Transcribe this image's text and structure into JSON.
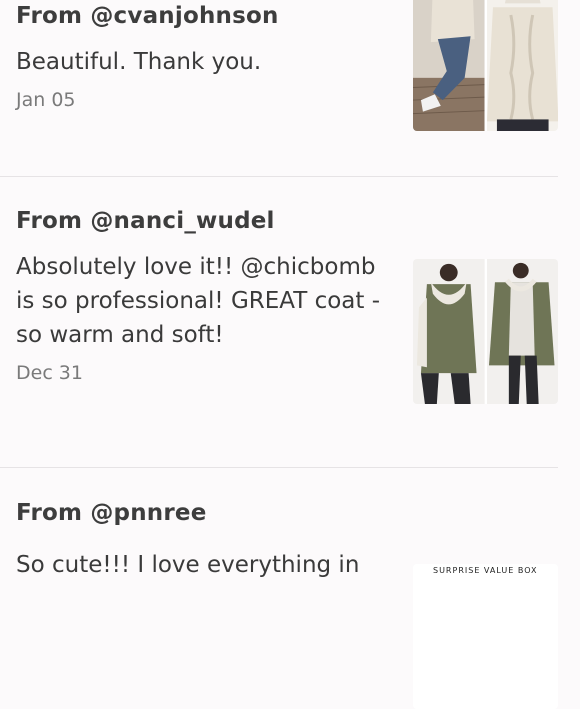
{
  "reviews": [
    {
      "author": "From @cvanjohnson",
      "message": "Beautiful. Thank you.",
      "date": "Jan 05",
      "photo": "cream-cable-knit-sweater-photo"
    },
    {
      "author": "From @nanci_wudel",
      "message": "Absolutely love it!! @chicbomb is so professional! GREAT coat - so warm and soft!",
      "date": "Dec 31",
      "photo": "olive-hooded-parka-photo"
    },
    {
      "author": "From @pnnree",
      "message": "So cute!!! I love everything in",
      "photo": "surprise-value-box-photo",
      "photo_label": "SURPRISE VALUE BOX"
    }
  ],
  "colors": {
    "background": "#fcfafb",
    "divider": "#e6e3e5",
    "text": "#3a3a3a",
    "muted": "#7a7a7a"
  }
}
